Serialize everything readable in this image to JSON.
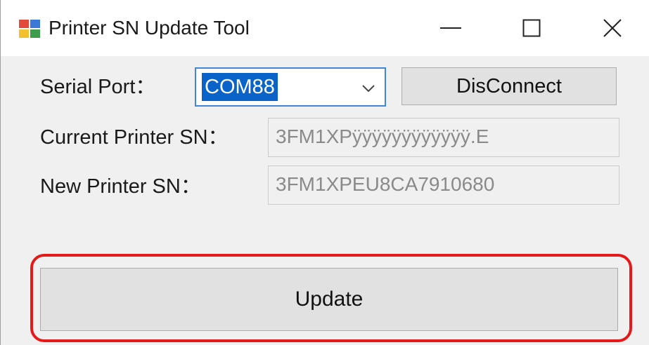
{
  "window": {
    "title": "Printer SN Update Tool",
    "controls": {
      "minimize_icon": "minimize-icon",
      "maximize_icon": "maximize-icon",
      "close_icon": "close-icon"
    }
  },
  "form": {
    "serial_port": {
      "label": "Serial Port：",
      "selected_value": "COM88"
    },
    "disconnect_label": "DisConnect",
    "current_sn": {
      "label": "Current Printer SN：",
      "value": "3FM1XPÿÿÿÿÿÿÿÿÿÿÿÿ.E"
    },
    "new_sn": {
      "label": "New Printer SN：",
      "value": "3FM1XPEU8CA7910680"
    },
    "update_label": "Update"
  },
  "colors": {
    "highlight": "#e41a1a",
    "selection": "#0a63c9",
    "focus_border": "#3f86d8"
  }
}
